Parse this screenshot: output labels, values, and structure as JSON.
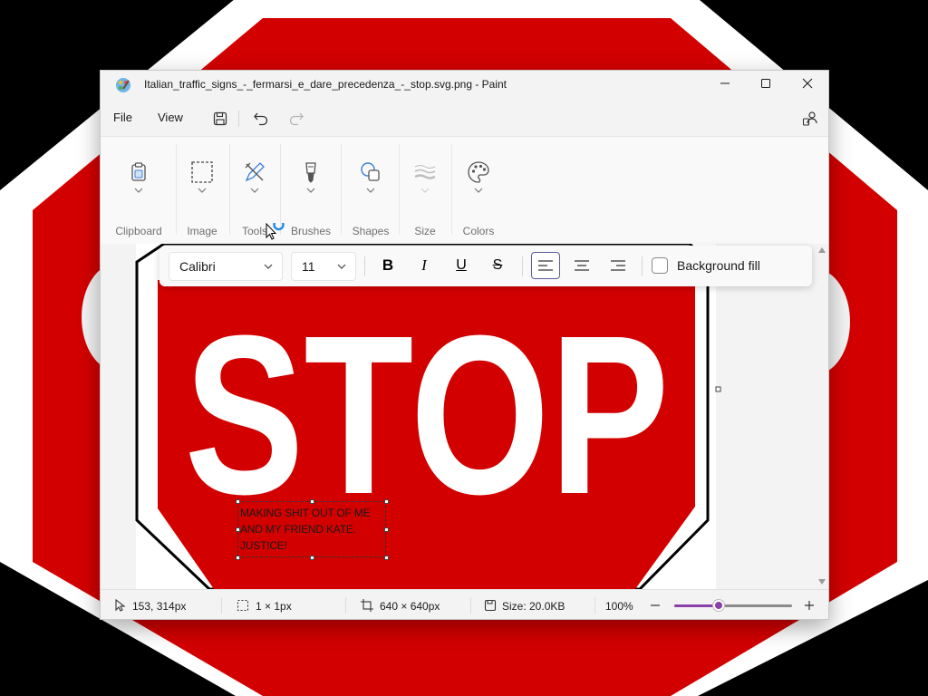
{
  "window": {
    "title": "Italian_traffic_signs_-_fermarsi_e_dare_precedenza_-_stop.svg.png - Paint",
    "controls": {
      "minimize_icon": "minimize-icon",
      "maximize_icon": "maximize-icon",
      "close_icon": "close-icon"
    }
  },
  "menubar": {
    "file_label": "File",
    "view_label": "View",
    "quick_actions": [
      "save-icon",
      "undo-icon",
      "redo-icon"
    ],
    "account_icon": "account-icon"
  },
  "ribbon": {
    "groups": [
      {
        "label": "Clipboard",
        "icon": "clipboard-icon"
      },
      {
        "label": "Image",
        "icon": "select-rect-icon"
      },
      {
        "label": "Tools",
        "icon": "pencil-tools-icon"
      },
      {
        "label": "Brushes",
        "icon": "brush-icon"
      },
      {
        "label": "Shapes",
        "icon": "shapes-icon"
      },
      {
        "label": "Size",
        "icon": "size-lines-icon"
      },
      {
        "label": "Colors",
        "icon": "palette-icon"
      }
    ]
  },
  "text_toolbar": {
    "font_family": "Calibri",
    "font_size": "11",
    "bold_label": "B",
    "italic_label": "I",
    "underline_label": "U",
    "strike_label": "S",
    "align": "left",
    "background_fill_label": "Background fill",
    "background_fill_checked": false
  },
  "canvas": {
    "sign_text": "STOP",
    "text_box_lines": [
      "MAKING SHIT OUT OF ME",
      "AND MY FRIEND KATE.",
      "JUSTICE!"
    ],
    "sign_color": "#d30000"
  },
  "statusbar": {
    "cursor_pos": "153, 314px",
    "selection_size": "1 × 1px",
    "canvas_size": "640 × 640px",
    "file_size": "Size: 20.0KB",
    "zoom": "100%",
    "zoom_fraction": 0.38
  },
  "colors": {
    "accent": "#8b3fa9",
    "stop_red": "#d30000"
  }
}
